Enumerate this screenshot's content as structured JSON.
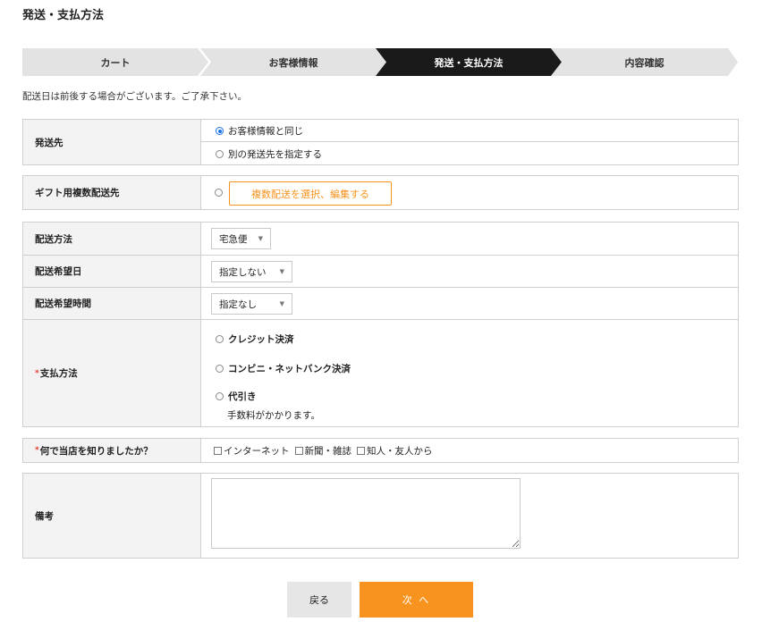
{
  "page": {
    "title": "発送・支払方法"
  },
  "steps": [
    {
      "label": "カート"
    },
    {
      "label": "お客様情報"
    },
    {
      "label": "発送・支払方法"
    },
    {
      "label": "内容確認"
    }
  ],
  "notice": "配送日は前後する場合がございます。ご了承下さい。",
  "shipping_to": {
    "label": "発送先",
    "options": [
      "お客様情報と同じ",
      "別の発送先を指定する"
    ],
    "selected": "お客様情報と同じ"
  },
  "gift": {
    "label": "ギフト用複数配送先",
    "button_label": "複数配送を選択、編集する"
  },
  "delivery": {
    "method_label": "配送方法",
    "method_value": "宅急便",
    "date_label": "配送希望日",
    "date_value": "指定しない",
    "time_label": "配送希望時間",
    "time_value": "指定なし"
  },
  "payment": {
    "required_mark": "*",
    "label": "支払方法",
    "options": [
      "クレジット決済",
      "コンビニ・ネットバンク決済",
      "代引き"
    ],
    "cod_note": "手数料がかかります。"
  },
  "survey": {
    "required_mark": "*",
    "label": "何で当店を知りましたか？",
    "options": [
      "インターネット",
      "新聞・雑誌",
      "知人・友人から"
    ]
  },
  "remarks": {
    "label": "備考",
    "value": ""
  },
  "buttons": {
    "back": "戻る",
    "next": "次 へ"
  },
  "colors": {
    "accent": "#f7931e",
    "active_step": "#1a1a1a",
    "required": "#e8412b"
  }
}
